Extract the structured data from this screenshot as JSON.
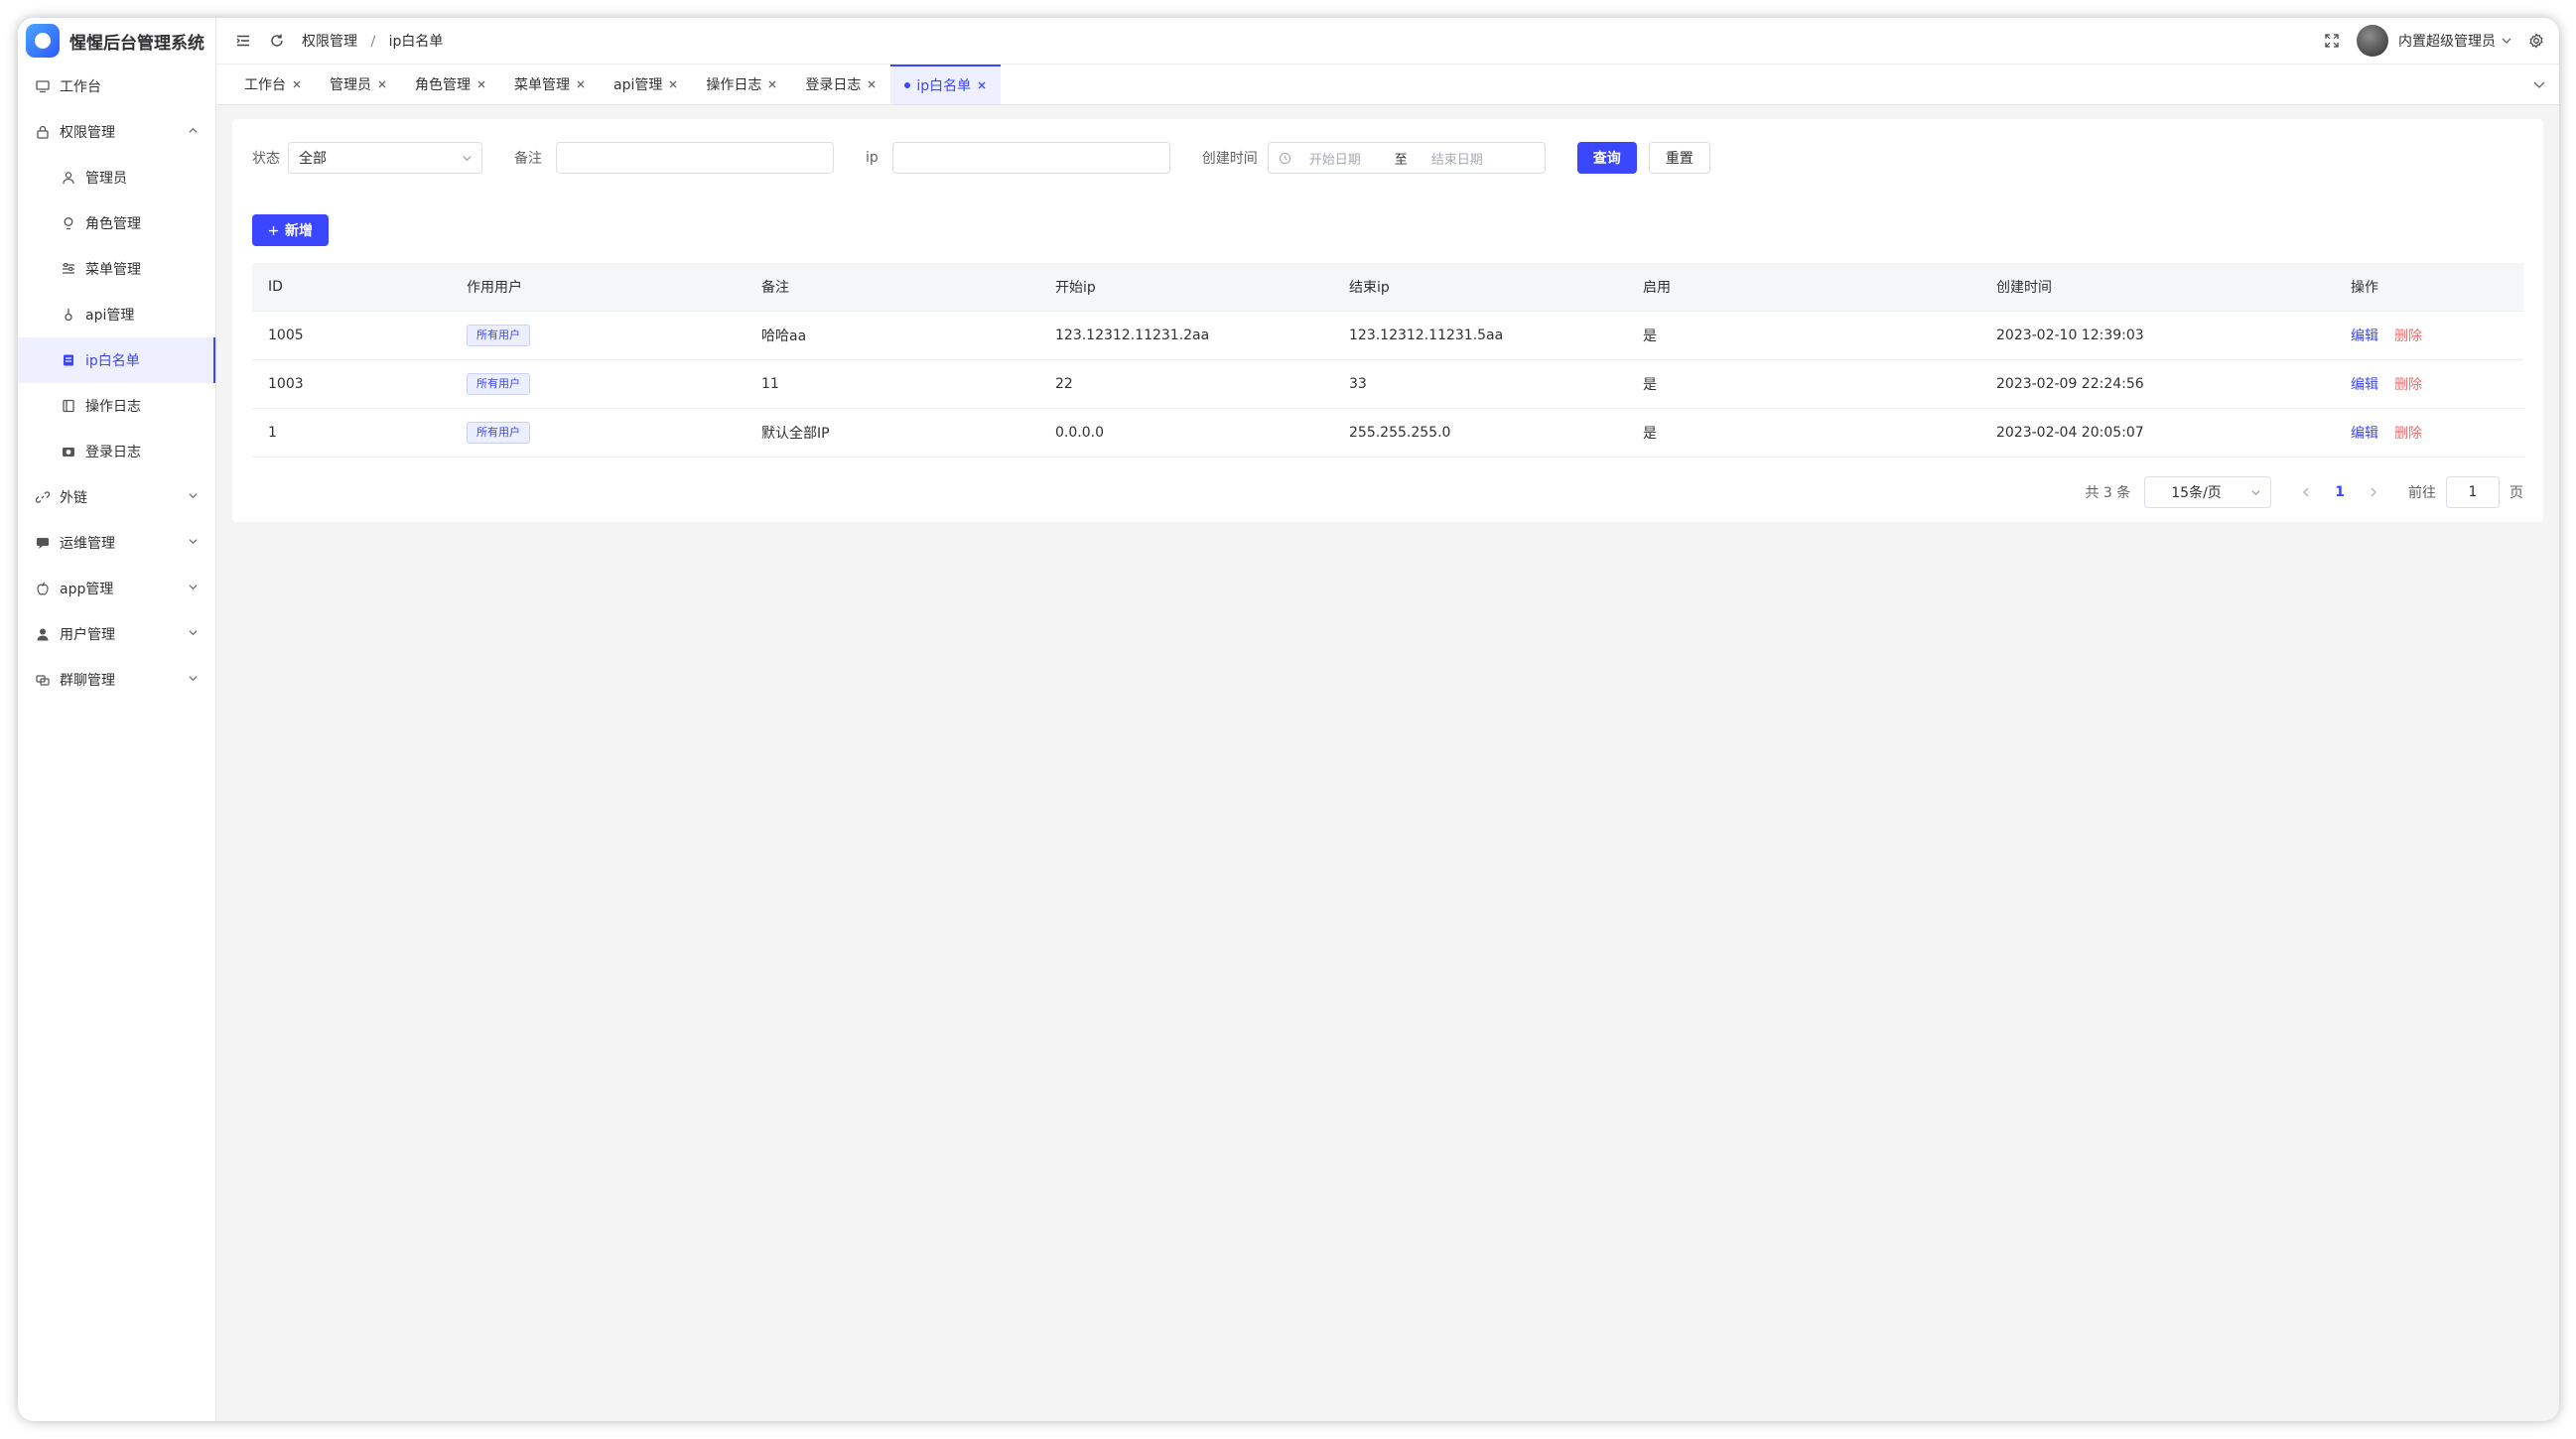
{
  "app": {
    "title": "惺惺后台管理系统"
  },
  "sidebar": {
    "items": [
      {
        "label": "工作台",
        "icon": "monitor-icon"
      },
      {
        "label": "权限管理",
        "icon": "lock-icon",
        "expanded": true
      },
      {
        "label": "管理员",
        "icon": "user-icon",
        "sub": true
      },
      {
        "label": "角色管理",
        "icon": "bulb-icon",
        "sub": true
      },
      {
        "label": "菜单管理",
        "icon": "sliders-icon",
        "sub": true
      },
      {
        "label": "api管理",
        "icon": "api-icon",
        "sub": true
      },
      {
        "label": "ip白名单",
        "icon": "list-icon",
        "sub": true,
        "active": true
      },
      {
        "label": "操作日志",
        "icon": "doc-icon",
        "sub": true
      },
      {
        "label": "登录日志",
        "icon": "camera-icon",
        "sub": true
      },
      {
        "label": "外链",
        "icon": "link-icon"
      },
      {
        "label": "运维管理",
        "icon": "chat-icon"
      },
      {
        "label": "app管理",
        "icon": "apple-icon"
      },
      {
        "label": "用户管理",
        "icon": "person-icon"
      },
      {
        "label": "群聊管理",
        "icon": "group-icon"
      }
    ]
  },
  "header": {
    "breadcrumb": [
      "权限管理",
      "ip白名单"
    ],
    "breadcrumb_sep": "/",
    "admin_name": "内置超级管理员"
  },
  "tabs": [
    {
      "label": "工作台"
    },
    {
      "label": "管理员"
    },
    {
      "label": "角色管理"
    },
    {
      "label": "菜单管理"
    },
    {
      "label": "api管理"
    },
    {
      "label": "操作日志"
    },
    {
      "label": "登录日志"
    },
    {
      "label": "ip白名单",
      "active": true
    }
  ],
  "filters": {
    "status_label": "状态",
    "status_value": "全部",
    "remark_label": "备注",
    "ip_label": "ip",
    "created_label": "创建时间",
    "start_placeholder": "开始日期",
    "range_sep": "至",
    "end_placeholder": "结束日期",
    "query_label": "查询",
    "reset_label": "重置"
  },
  "add_label": "新增",
  "table": {
    "headers": [
      "ID",
      "作用用户",
      "备注",
      "开始ip",
      "结束ip",
      "启用",
      "创建时间",
      "操作"
    ],
    "rows": [
      {
        "id": "1005",
        "scope": "所有用户",
        "remark": "哈哈aa",
        "start_ip": "123.12312.11231.2aa",
        "end_ip": "123.12312.11231.5aa",
        "enabled": "是",
        "created": "2023-02-10 12:39:03",
        "edit": "编辑",
        "delete": "删除"
      },
      {
        "id": "1003",
        "scope": "所有用户",
        "remark": "11",
        "start_ip": "22",
        "end_ip": "33",
        "enabled": "是",
        "created": "2023-02-09 22:24:56",
        "edit": "编辑",
        "delete": "删除"
      },
      {
        "id": "1",
        "scope": "所有用户",
        "remark": "默认全部IP",
        "start_ip": "0.0.0.0",
        "end_ip": "255.255.255.0",
        "enabled": "是",
        "created": "2023-02-04 20:05:07",
        "edit": "编辑",
        "delete": "删除"
      }
    ]
  },
  "pager": {
    "total": "共 3 条",
    "page_size": "15条/页",
    "current": "1",
    "goto_label": "前往",
    "goto_value": "1",
    "page_unit": "页"
  },
  "colors": {
    "accent": "#3a46ff",
    "danger": "#f56c6c"
  }
}
